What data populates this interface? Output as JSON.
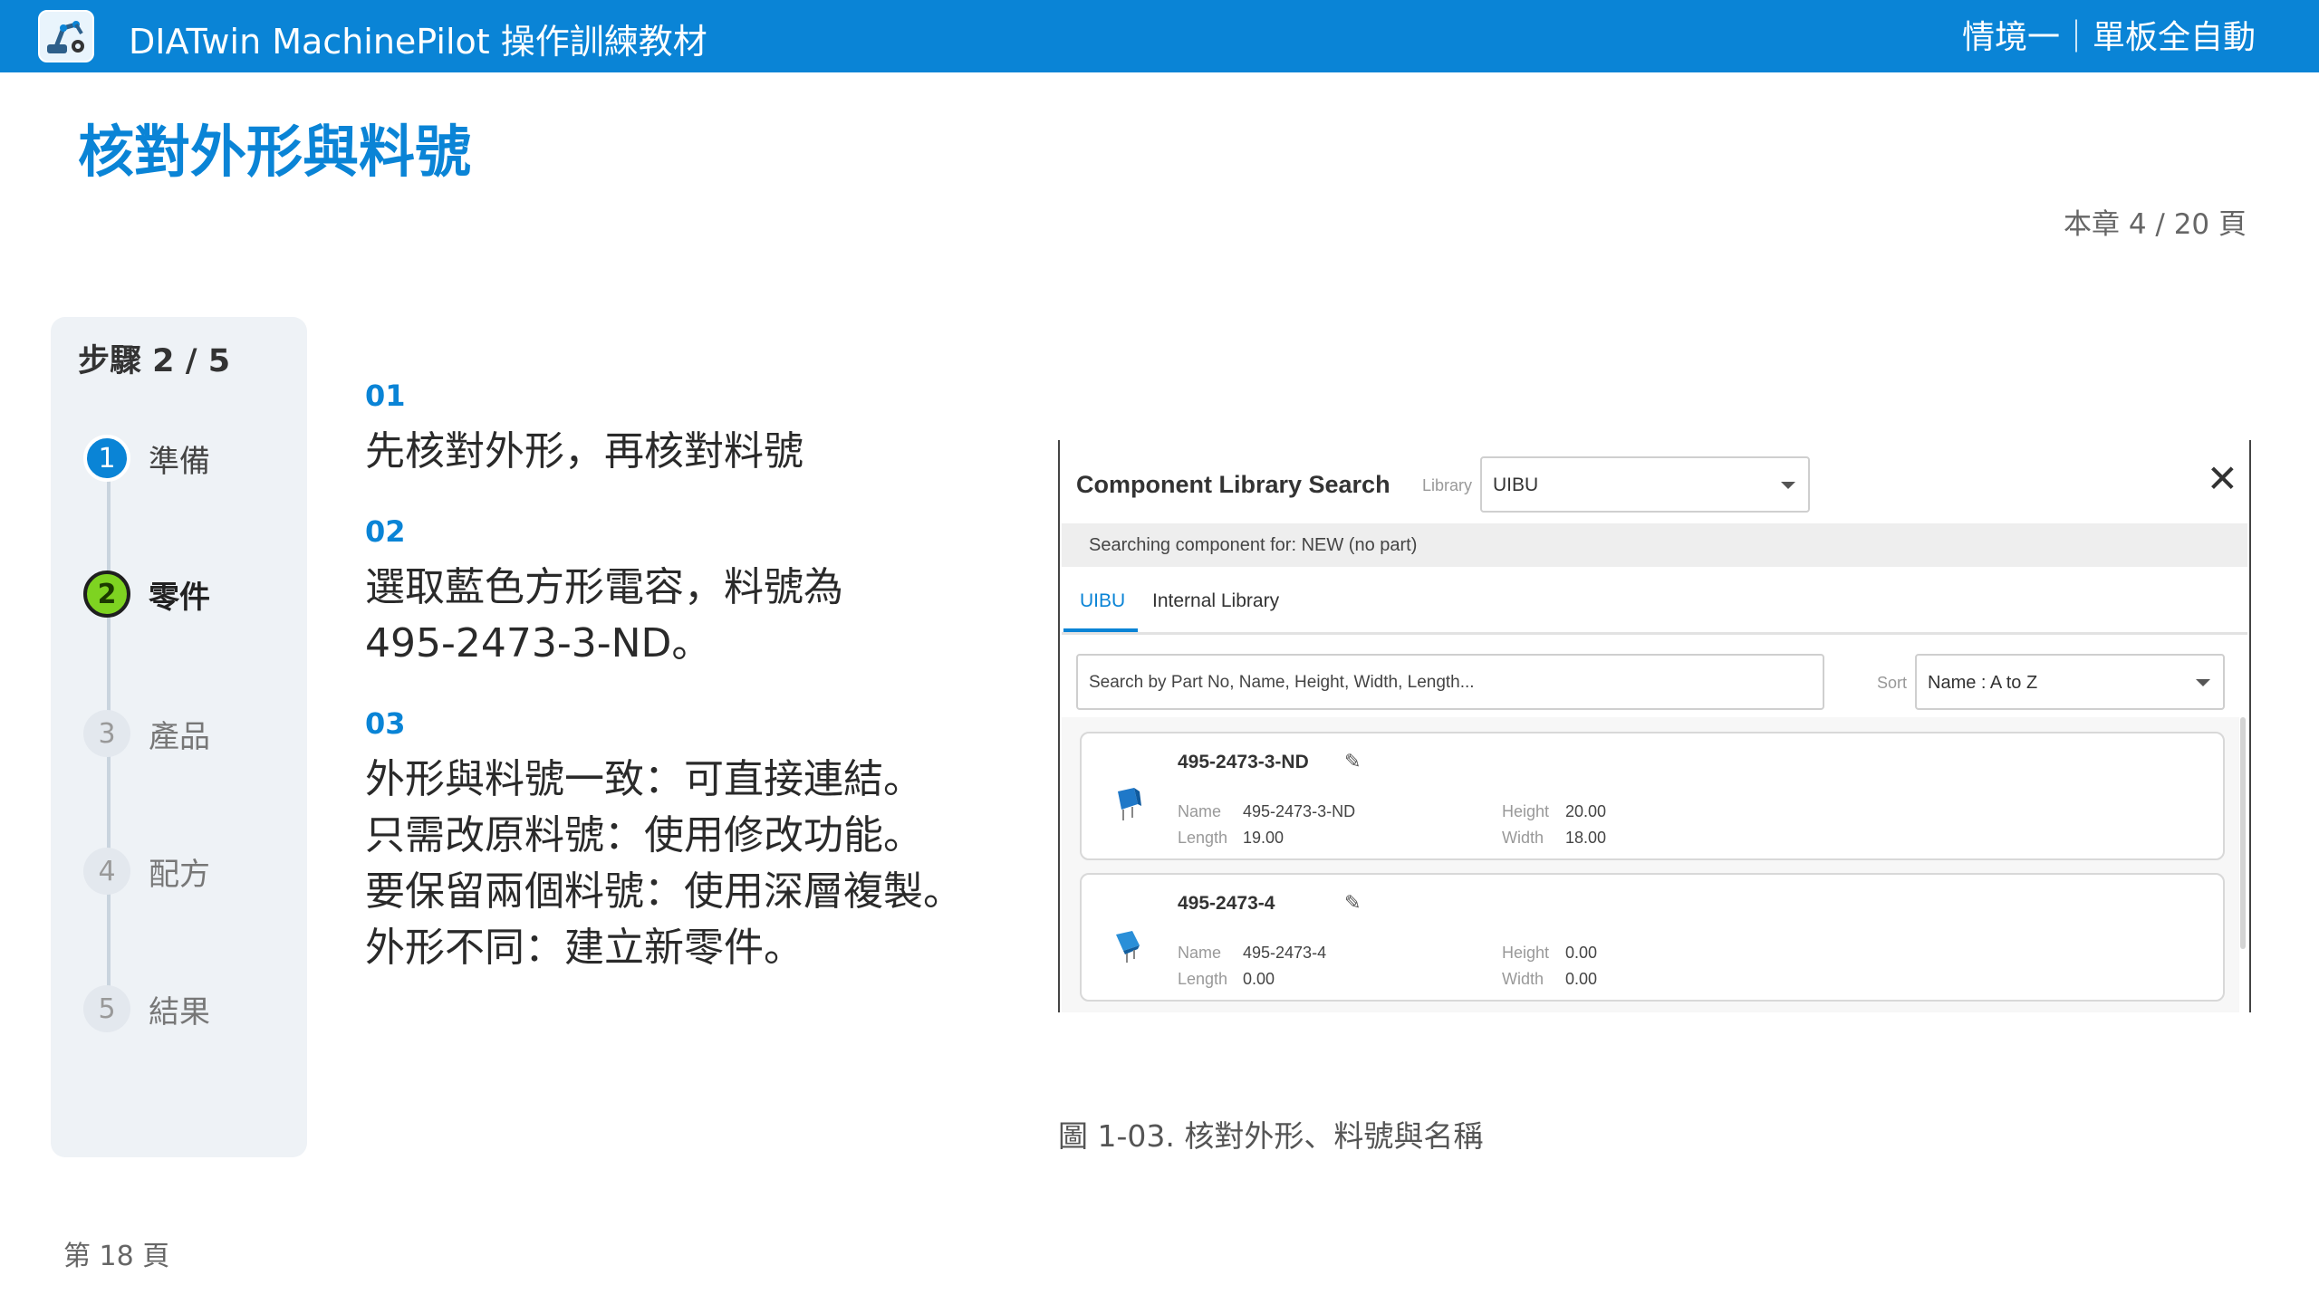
{
  "header": {
    "app_title": "DIATwin MachinePilot 操作訓練教材",
    "scenario": "情境一｜單板全自動",
    "accent_color": "#0a84d6",
    "logo_icon": "robot-arm-logo-icon"
  },
  "page": {
    "title": "核對外形與料號",
    "chapter_progress": "本章 4 / 20 頁",
    "page_number": "第 18 頁"
  },
  "stepper": {
    "count": "步驟 2 / 5",
    "steps": [
      {
        "num": "1",
        "label": "準備",
        "state": "done"
      },
      {
        "num": "2",
        "label": "零件",
        "state": "active"
      },
      {
        "num": "3",
        "label": "產品",
        "state": "pending"
      },
      {
        "num": "4",
        "label": "配方",
        "state": "pending"
      },
      {
        "num": "5",
        "label": "結果",
        "state": "pending"
      }
    ]
  },
  "instructions": [
    {
      "num": "01",
      "lines": [
        "先核對外形，再核對料號"
      ]
    },
    {
      "num": "02",
      "lines": [
        "選取藍色方形電容，料號為",
        "495-2473-3-ND。"
      ]
    },
    {
      "num": "03",
      "lines": [
        "外形與料號一致：可直接連結。",
        "只需改原料號：使用修改功能。",
        "要保留兩個料號：使用深層複製。",
        "外形不同：建立新零件。"
      ]
    }
  ],
  "figure": {
    "title": "Component Library Search",
    "library_label": "Library",
    "library_value": "UIBU",
    "close_icon": "close-icon",
    "status": "Searching component for: NEW (no part)",
    "tabs": [
      "UIBU",
      "Internal Library"
    ],
    "search_placeholder": "Search by Part No, Name, Height, Width, Length...",
    "sort_label": "Sort",
    "sort_value": "Name : A to Z",
    "results": [
      {
        "part": "495-2473-3-ND",
        "name_label": "Name",
        "name": "495-2473-3-ND",
        "length_label": "Length",
        "length": "19.00",
        "height_label": "Height",
        "height": "20.00",
        "width_label": "Width",
        "width": "18.00"
      },
      {
        "part": "495-2473-4",
        "name_label": "Name",
        "name": "495-2473-4",
        "length_label": "Length",
        "length": "0.00",
        "height_label": "Height",
        "height": "0.00",
        "width_label": "Width",
        "width": "0.00"
      }
    ],
    "caption": "圖 1-03. 核對外形、料號與名稱"
  }
}
